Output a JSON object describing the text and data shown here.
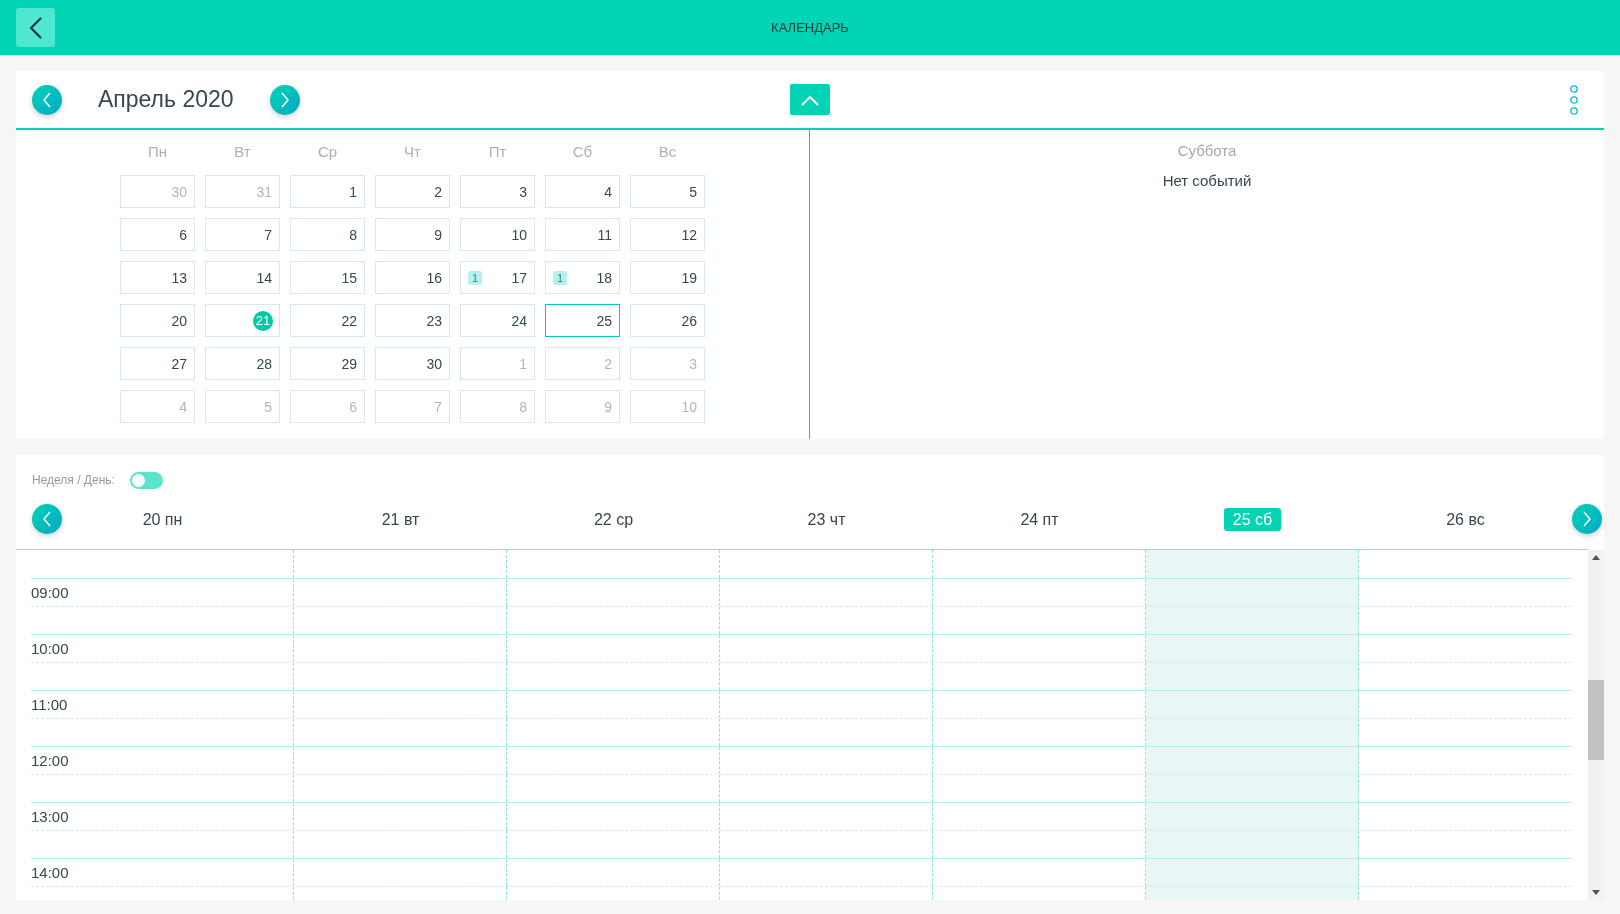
{
  "header": {
    "title": "КАЛЕНДАРЬ"
  },
  "month": {
    "title": "Апрель 2020",
    "weekdays": [
      "Пн",
      "Вт",
      "Ср",
      "Чт",
      "Пт",
      "Сб",
      "Вс"
    ],
    "weeks": [
      [
        {
          "day": "30",
          "outside": true
        },
        {
          "day": "31",
          "outside": true
        },
        {
          "day": "1"
        },
        {
          "day": "2"
        },
        {
          "day": "3"
        },
        {
          "day": "4"
        },
        {
          "day": "5"
        }
      ],
      [
        {
          "day": "6"
        },
        {
          "day": "7"
        },
        {
          "day": "8"
        },
        {
          "day": "9"
        },
        {
          "day": "10"
        },
        {
          "day": "11"
        },
        {
          "day": "12"
        }
      ],
      [
        {
          "day": "13"
        },
        {
          "day": "14"
        },
        {
          "day": "15"
        },
        {
          "day": "16"
        },
        {
          "day": "17",
          "badge": "1"
        },
        {
          "day": "18",
          "badge": "1"
        },
        {
          "day": "19"
        }
      ],
      [
        {
          "day": "20"
        },
        {
          "day": "21",
          "today": true
        },
        {
          "day": "22"
        },
        {
          "day": "23"
        },
        {
          "day": "24"
        },
        {
          "day": "25",
          "selected": true
        },
        {
          "day": "26"
        }
      ],
      [
        {
          "day": "27"
        },
        {
          "day": "28"
        },
        {
          "day": "29"
        },
        {
          "day": "30"
        },
        {
          "day": "1",
          "outside": true
        },
        {
          "day": "2",
          "outside": true
        },
        {
          "day": "3",
          "outside": true
        }
      ],
      [
        {
          "day": "4",
          "outside": true
        },
        {
          "day": "5",
          "outside": true
        },
        {
          "day": "6",
          "outside": true
        },
        {
          "day": "7",
          "outside": true
        },
        {
          "day": "8",
          "outside": true
        },
        {
          "day": "9",
          "outside": true
        },
        {
          "day": "10",
          "outside": true
        }
      ]
    ]
  },
  "day_panel": {
    "weekday": "Суббота",
    "message": "Нет событий"
  },
  "week": {
    "toggle_label": "Неделя / День:",
    "toggle_on": false,
    "days": [
      {
        "label": "20 пн",
        "selected": false
      },
      {
        "label": "21 вт",
        "selected": false
      },
      {
        "label": "22 ср",
        "selected": false
      },
      {
        "label": "23 чт",
        "selected": false
      },
      {
        "label": "24 пт",
        "selected": false
      },
      {
        "label": "25 сб",
        "selected": true
      },
      {
        "label": "26 вс",
        "selected": false
      }
    ],
    "times": [
      "09:00",
      "10:00",
      "11:00",
      "12:00",
      "13:00",
      "14:00"
    ]
  }
}
